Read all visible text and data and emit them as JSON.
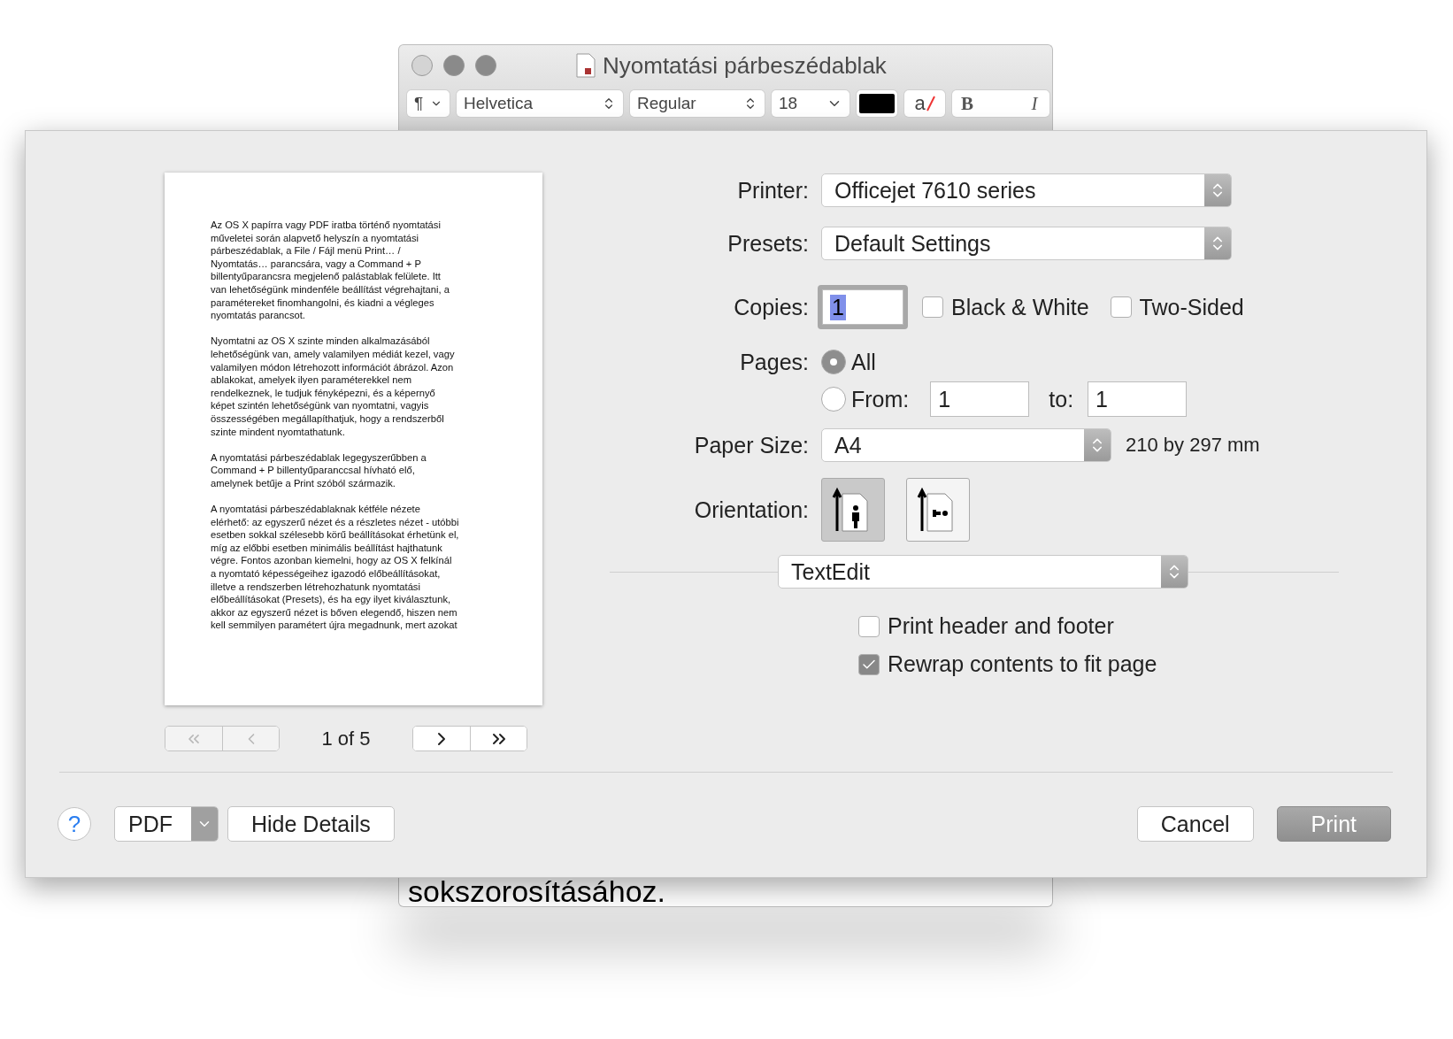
{
  "window": {
    "title": "Nyomtatási párbeszédablak"
  },
  "toolbar": {
    "paragraph": "¶",
    "font": "Helvetica",
    "style": "Regular",
    "size": "18",
    "highlight_letter": "a",
    "bold": "B",
    "italic": "I"
  },
  "preview": {
    "paragraphs": [
      "Az OS X papírra vagy PDF iratba történő nyomtatási\nműveletei során alapvető helyszín a nyomtatási\npárbeszédablak, a File / Fájl menü Print… /\nNyomtatás… parancsára, vagy a Command + P\nbillentyűparancsra megjelenő palástablak felülete. Itt\nvan lehetőségünk mindenféle beállítást végrehajtani, a\nparamétereket finomhangolni, és kiadni a végleges\nnyomtatás parancsot.",
      "Nyomtatni az OS X szinte minden alkalmazásából\nlehetőségünk van, amely valamilyen médiát kezel, vagy\nvalamilyen módon létrehozott információt ábrázol. Azon\nablakokat, amelyek ilyen paraméterekkel nem\nrendelkeznek, le tudjuk fényképezni, és a képernyő\nképet szintén lehetőségünk van nyomtatni, vagyis\nösszességében megállapíthatjuk, hogy a rendszerből\nszinte mindent nyomtathatunk.",
      "A nyomtatási párbeszédablak legegyszerűbben a\nCommand + P billentyűparanccsal hívható elő,\namelynek betűje a Print szóból származik.",
      "A nyomtatási párbeszédablaknak kétféle nézete\nelérhető: az egyszerű nézet és a részletes nézet - utóbbi\nesetben sokkal szélesebb körű beállításokat érhetünk el,\nmíg az előbbi esetben minimális beállítást hajthatunk\nvégre. Fontos azonban kiemelni, hogy az OS X felkínál\na nyomtató képességeihez igazodó előbeállításokat,\nilletve a rendszerben létrehozhatunk nyomtatási\nelőbeállításokat (Presets), és ha egy ilyet kiválasztunk,\nakkor az egyszerű nézet is bőven elegendő, hiszen nem\nkell semmilyen paramétert újra megadnunk, mert azokat"
    ],
    "nav": [
      {
        "kind": "first",
        "disabled": true
      },
      {
        "kind": "prev",
        "disabled": true
      },
      {
        "kind": "next",
        "disabled": false
      },
      {
        "kind": "last",
        "disabled": false
      }
    ],
    "page_indicator": "1 of 5"
  },
  "form": {
    "printer": {
      "label": "Printer:",
      "value": "Officejet 7610 series"
    },
    "presets": {
      "label": "Presets:",
      "value": "Default Settings"
    },
    "copies": {
      "label": "Copies:",
      "value": "1",
      "options": [
        {
          "label": "Black & White",
          "checked": false
        },
        {
          "label": "Two-Sided",
          "checked": false
        }
      ]
    },
    "pages": {
      "label": "Pages:",
      "options": [
        {
          "label": "All",
          "selected": true
        },
        {
          "label": "From:",
          "selected": false
        }
      ],
      "from": "1",
      "to_label": "to:",
      "to": "1"
    },
    "paper_size": {
      "label": "Paper Size:",
      "value": "A4",
      "dimensions": "210 by 297 mm"
    },
    "orientation": {
      "label": "Orientation:",
      "options": [
        {
          "kind": "portrait",
          "selected": true
        },
        {
          "kind": "landscape",
          "selected": false
        }
      ]
    },
    "app_section": "TextEdit",
    "app_options": [
      {
        "label": "Print header and footer",
        "checked": false
      },
      {
        "label": "Rewrap contents to fit page",
        "checked": true
      }
    ]
  },
  "footer": {
    "help": "?",
    "pdf": "PDF",
    "hide_details": "Hide Details",
    "cancel": "Cancel",
    "print": "Print"
  },
  "document_text": "sokszorosításához."
}
